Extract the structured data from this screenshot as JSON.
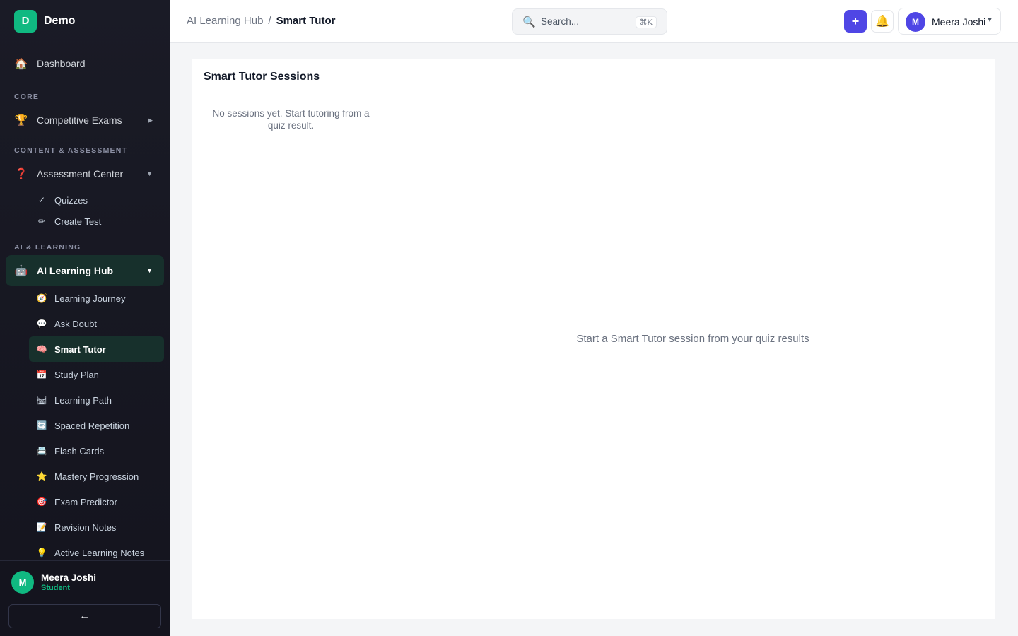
{
  "brand": {
    "logo_letter": "D",
    "name": "Demo",
    "logo_color": "#10b981"
  },
  "sidebar": {
    "dashboard": {
      "icon": "home-icon",
      "glyph": "🏠",
      "label": "Dashboard"
    },
    "sections": {
      "core": "CORE",
      "content": "CONTENT & ASSESSMENT",
      "ai": "AI & LEARNING"
    },
    "competitive_exams": {
      "icon": "trophy-icon",
      "glyph": "🏆",
      "label": "Competitive Exams"
    },
    "assessment_center": {
      "icon": "question-icon",
      "glyph": "❓",
      "label": "Assessment Center",
      "items": [
        {
          "icon": "check-icon",
          "glyph": "✓",
          "label": "Quizzes"
        },
        {
          "icon": "pencil-icon",
          "glyph": "✏",
          "label": "Create Test"
        }
      ]
    },
    "ai_hub": {
      "icon": "robot-icon",
      "glyph": "🤖",
      "label": "AI Learning Hub",
      "items": [
        {
          "icon": "compass-icon",
          "glyph": "🧭",
          "label": "Learning Journey"
        },
        {
          "icon": "speech-bubble-icon",
          "glyph": "💬",
          "label": "Ask Doubt"
        },
        {
          "icon": "brain-icon",
          "glyph": "🧠",
          "label": "Smart Tutor"
        },
        {
          "icon": "calendar-icon",
          "glyph": "📅",
          "label": "Study Plan"
        },
        {
          "icon": "railway-track-icon",
          "glyph": "🛤",
          "label": "Learning Path"
        },
        {
          "icon": "repeat-icon",
          "glyph": "🔄",
          "label": "Spaced Repetition"
        },
        {
          "icon": "card-index-icon",
          "glyph": "📇",
          "label": "Flash Cards"
        },
        {
          "icon": "star-icon",
          "glyph": "⭐",
          "label": "Mastery Progression"
        },
        {
          "icon": "target-icon",
          "glyph": "🎯",
          "label": "Exam Predictor"
        },
        {
          "icon": "memo-icon",
          "glyph": "📝",
          "label": "Revision Notes"
        },
        {
          "icon": "lightbulb-icon",
          "glyph": "💡",
          "label": "Active Learning Notes"
        }
      ]
    },
    "user": {
      "initial": "M",
      "name": "Meera Joshi",
      "role": "Student"
    },
    "collapse_glyph": "←"
  },
  "header": {
    "breadcrumb_parent": "AI Learning Hub",
    "breadcrumb_sep": "/",
    "breadcrumb_current": "Smart Tutor",
    "search_placeholder": "Search...",
    "search_shortcut": "⌘K",
    "add_glyph": "+",
    "bell_glyph": "🔔",
    "user_initial": "M",
    "user_name": "Meera Joshi",
    "accent_color": "#4f46e5"
  },
  "main": {
    "sessions_title": "Smart Tutor Sessions",
    "sessions_empty": "No sessions yet. Start tutoring from a quiz result.",
    "tutor_empty": "Start a Smart Tutor session from your quiz results"
  }
}
